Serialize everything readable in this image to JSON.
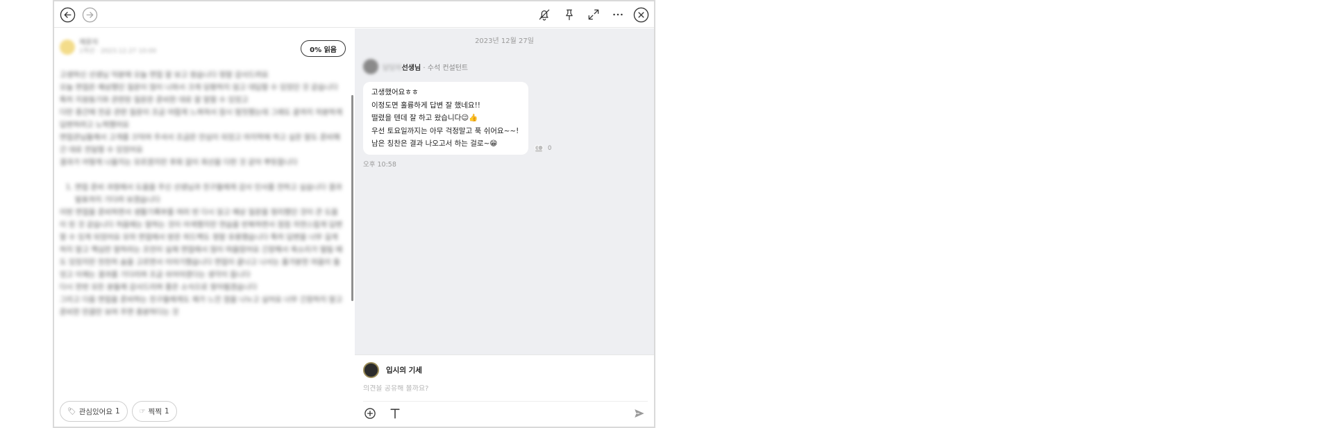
{
  "window": {
    "nav": {
      "back_icon": "arrow-left-circle-icon",
      "forward_icon": "arrow-right-circle-icon"
    },
    "toolbar": {
      "icons": [
        "notification-off-icon",
        "pin-icon",
        "expand-icon",
        "more-icon",
        "close-circle-icon"
      ]
    }
  },
  "post": {
    "author_name": "재윤자",
    "author_sub": "1학년 · 2023.12.27 10:00",
    "read_badge": "0% 읽음",
    "paragraphs": [
      "고생하신 선생님 덕분에 오늘 면접 잘 보고 왔습니다 정말 감사드려요",
      "오늘 면접은 예상했던 질문이 많이 나와서 크게 당황하지 않고 대답할 수 있었던 것 같습니다 특히 지원동기와 관련된 질문은 준비한 대로 잘 말할 수 있었고",
      "다만 중간에 전공 관련 질문이 조금 어렵게 느껴져서 잠시 멈칫했는데 그래도 끝까지 차분하게 답변하려고 노력했어요",
      "면접관님들께서 고개를 끄덕여 주셔서 조금은 안심이 되었고 마지막에 하고 싶은 말도 준비해 간 대로 전달할 수 있었어요",
      "결과가 어떻게 나올지는 모르겠지만 후회 없이 최선을 다한 것 같아 뿌듯합니다"
    ],
    "list_item": "면접 준비 과정에서 도움을 주신 선생님과 친구들에게 감사 인사를 전하고 싶습니다 결과 발표까지 기다려 보겠습니다",
    "paragraphs_after": [
      "이번 면접을 준비하면서 생활기록부를 여러 번 다시 읽고 예상 질문을 정리했던 것이 큰 도움이 된 것 같습니다 처음에는 말하는 것이 어색했지만 연습을 반복하면서 점점 자연스럽게 답변할 수 있게 되었어요 모의 면접에서 받은 피드백도 정말 유용했습니다 특히 답변을 너무 길게 하지 말고 핵심만 말하라는 조언이 실제 면접에서 많이 떠올랐어요 긴장해서 목소리가 떨릴 때도 있었지만 천천히 숨을 고르면서 이야기했습니다 면접이 끝나고 나서는 홀가분한 마음이 들었고 이제는 결과를 기다리며 조금 쉬어야겠다는 생각이 듭니다",
      "다시 한번 모든 분들께 감사드리며 좋은 소식으로 찾아뵙겠습니다",
      "그리고 다음 면접을 준비하는 친구들에게도 제가 느낀 점을 나누고 싶어요 너무 긴장하지 말고 준비한 만큼만 보여 주면 충분하다는 것"
    ],
    "reactions": [
      {
        "icon": "tag-icon",
        "label": "관심있어요",
        "count": "1"
      },
      {
        "icon": "thumbs-icon",
        "label": "찍찍",
        "count": "1"
      }
    ]
  },
  "chat": {
    "date": "2023년 12월 27일",
    "sender": {
      "name_blur": "담당자",
      "name": "선생님",
      "role": " · 수석 컨설턴트"
    },
    "message_lines": [
      "고생했어요ㅎㅎ",
      "이정도면 훌륭하게 답변 잘 했네요!!",
      "떨렸을 텐데 잘 하고 왔습니다😉👍",
      "우선 토요일까지는 아무 걱정말고 푹 쉬어요~~!",
      "남은 칭찬은 결과 나오고서 하는 걸로~😁"
    ],
    "read_count": "0",
    "time": "오후 10:58"
  },
  "composer": {
    "name": "입시의 기세",
    "placeholder": "의견을 공유해 볼까요?",
    "tools": [
      "add-circle-icon",
      "text-format-icon"
    ],
    "send_icon": "send-icon"
  },
  "colors": {
    "chat_bg": "#eeeff2",
    "bubble_bg": "#ffffff",
    "border": "#d9d9d9"
  }
}
